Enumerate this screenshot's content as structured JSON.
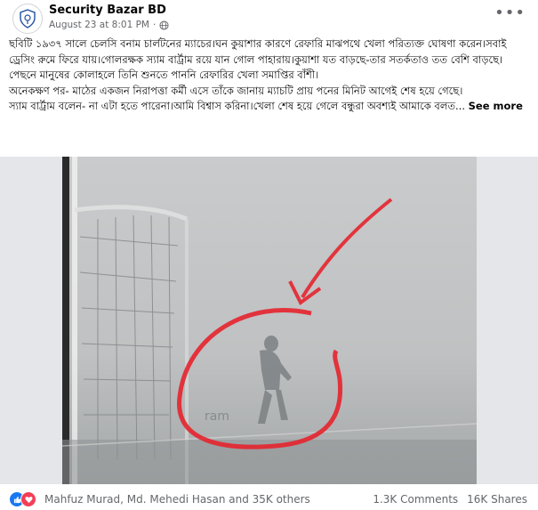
{
  "post": {
    "page_name": "Security Bazar BD",
    "timestamp": "August 23 at 8:01 PM",
    "privacy_icon": "globe-icon",
    "text_p1": "ছবিটি ১৯৩৭ সালে চেলসি বনাম চার্লটনের ম্যাচের।ঘন কুয়াশার কারণে রেফারি মাঝপথে খেলা পরিত্যক্ত ঘোষণা করেন।সবাই ড্রেসিং রুমে ফিরে যায়।গোলরক্ষক স্যাম বার্ট্রাম রয়ে যান গোল পাহারায়।কুয়াশা যত বাড়ছে-তার সতর্কতাও তত বেশি বাড়ছে।পেছনে মানুষের কোলাহলে তিনি শুনতে পাননি রেফারির খেলা সমাপ্তির বাঁশী।",
    "text_p2": "অনেকক্ষণ পর- মাঠের একজন নিরাপত্তা কর্মী এসে তাঁকে জানায় ম্যাচটি প্রায় পনের মিনিট আগেই শেষ হয়ে গেছে।",
    "text_p3": "স্যাম বার্ট্রাম বলেন- না এটা হতে পারেনা।আমি বিশ্বাস করিনা।খেলা শেষ হয়ে গেলে বন্ধুরা অবশ্যই আমাকে বলত...",
    "see_more": "See more",
    "watermark": "ram"
  },
  "footer": {
    "reactors": "Mahfuz Murad, Md. Mehedi Hasan and 35K others",
    "comments": "1.3K Comments",
    "shares": "16K Shares"
  },
  "colors": {
    "like": "#1877f2",
    "love": "#f33e58",
    "highlight": "#e5232d"
  }
}
